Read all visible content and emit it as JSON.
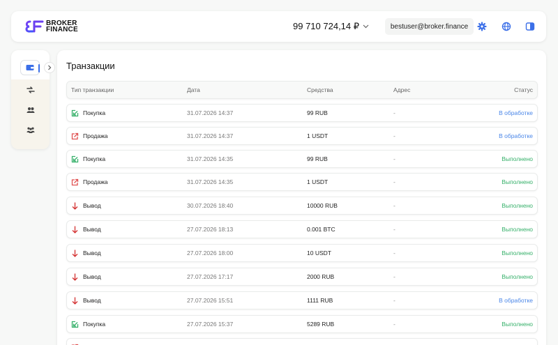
{
  "header": {
    "logo_line1": "BROKER",
    "logo_line2": "FINANCE",
    "balance": "99 710 724,14 ₽",
    "email": "bestuser@broker.finance"
  },
  "icons": {
    "settings": "gear-icon",
    "language": "globe-icon",
    "theme": "theme-toggle-icon",
    "wallet": "wallet-icon",
    "expand": "chevron-right-icon",
    "exchange": "exchange-icon",
    "users": "users-icon",
    "partners": "handshake-icon"
  },
  "main": {
    "title": "Транзакции",
    "columns": {
      "type": "Тип транзакции",
      "date": "Дата",
      "amount": "Средства",
      "address": "Адрес",
      "status": "Статус"
    },
    "rows": [
      {
        "kind": "buy",
        "type": "Покупка",
        "date": "31.07.2026 14:37",
        "amount": "99 RUB",
        "address": "-",
        "status": "В обработке",
        "state": "processing"
      },
      {
        "kind": "sell",
        "type": "Продажа",
        "date": "31.07.2026 14:37",
        "amount": "1 USDT",
        "address": "-",
        "status": "В обработке",
        "state": "processing"
      },
      {
        "kind": "buy",
        "type": "Покупка",
        "date": "31.07.2026 14:35",
        "amount": "99 RUB",
        "address": "-",
        "status": "Выполнено",
        "state": "done"
      },
      {
        "kind": "sell",
        "type": "Продажа",
        "date": "31.07.2026 14:35",
        "amount": "1 USDT",
        "address": "-",
        "status": "Выполнено",
        "state": "done"
      },
      {
        "kind": "withdraw",
        "type": "Вывод",
        "date": "30.07.2026 18:40",
        "amount": "10000 RUB",
        "address": "-",
        "status": "Выполнено",
        "state": "done"
      },
      {
        "kind": "withdraw",
        "type": "Вывод",
        "date": "27.07.2026 18:13",
        "amount": "0.001 BTC",
        "address": "-",
        "status": "Выполнено",
        "state": "done"
      },
      {
        "kind": "withdraw",
        "type": "Вывод",
        "date": "27.07.2026 18:00",
        "amount": "10 USDT",
        "address": "-",
        "status": "Выполнено",
        "state": "done"
      },
      {
        "kind": "withdraw",
        "type": "Вывод",
        "date": "27.07.2026 17:17",
        "amount": "2000 RUB",
        "address": "-",
        "status": "Выполнено",
        "state": "done"
      },
      {
        "kind": "withdraw",
        "type": "Вывод",
        "date": "27.07.2026 15:51",
        "amount": "1111 RUB",
        "address": "-",
        "status": "В обработке",
        "state": "processing"
      },
      {
        "kind": "buy",
        "type": "Покупка",
        "date": "27.07.2026 15:37",
        "amount": "5289 RUB",
        "address": "-",
        "status": "Выполнено",
        "state": "done"
      }
    ]
  },
  "colors": {
    "processing": "#4a86e8",
    "done": "#36b06a",
    "buy_icon": "#36b06a",
    "sell_icon": "#e05252",
    "withdraw_icon": "#d32f2f",
    "accent": "#4a6cf7"
  }
}
